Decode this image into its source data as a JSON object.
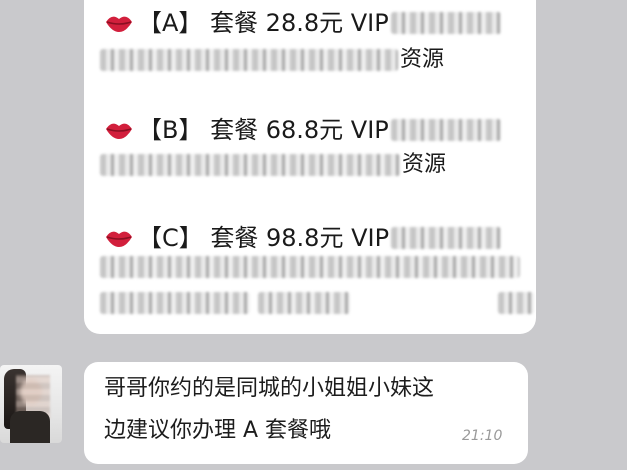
{
  "packages": [
    {
      "label": "【A】 套餐 28.8元  VIP",
      "tail": "资源"
    },
    {
      "label": "【B】 套餐 68.8元  VIP",
      "tail": "资源"
    },
    {
      "label": "【C】 套餐 98.8元    VIP"
    }
  ],
  "reply": {
    "line1": "哥哥你约的是同城的小姐姐小妹这",
    "line2": "边建议你办理 A 套餐哦",
    "time": "21:10"
  },
  "icons": {
    "package": "lips-icon"
  },
  "colors": {
    "background": "#c9c9cc",
    "bubble": "#ffffff",
    "lips": "#d21f3c"
  }
}
